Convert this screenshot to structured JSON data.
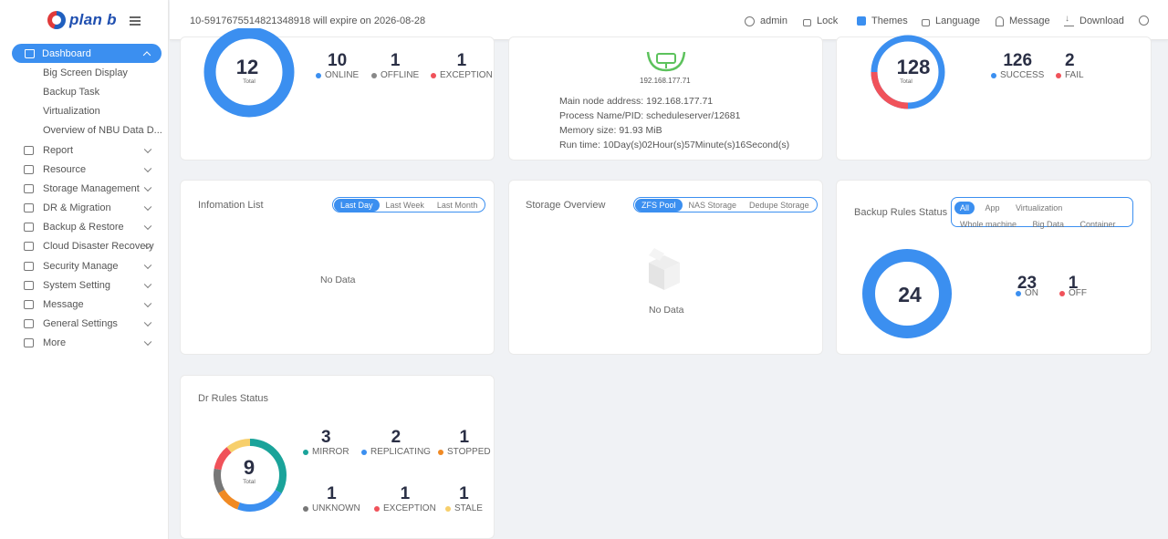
{
  "brand": {
    "logo_text": "plan b"
  },
  "header": {
    "expire_text": "10-5917675514821348918 will expire on 2026-08-28",
    "user": "admin",
    "lock": "Lock",
    "themes": "Themes",
    "language": "Language",
    "message": "Message",
    "download": "Download"
  },
  "sidebar": {
    "active": "Dashboard",
    "sub_items": [
      "Big Screen Display",
      "Backup Task",
      "Virtualization",
      "Overview of NBU Data D..."
    ],
    "items": [
      "Report",
      "Resource",
      "Storage Management",
      "DR & Migration",
      "Backup & Restore",
      "Cloud Disaster Recovery",
      "Security Manage",
      "System Setting",
      "Message",
      "General Settings",
      "More"
    ]
  },
  "client_card": {
    "total": "12",
    "total_label": "Total",
    "stats": [
      {
        "value": "10",
        "label": "ONLINE",
        "color": "#3b8ff0"
      },
      {
        "value": "1",
        "label": "OFFLINE",
        "color": "#888888"
      },
      {
        "value": "1",
        "label": "EXCEPTION",
        "color": "#f0525a"
      }
    ]
  },
  "node_card": {
    "ip": "192.168.177.71",
    "lines": [
      "Main node address: 192.168.177.71",
      "Process Name/PID: scheduleserver/12681",
      "Memory size: 91.93 MiB",
      "Run time: 10Day(s)02Hour(s)57Minute(s)16Second(s)"
    ]
  },
  "task_card": {
    "total": "128",
    "total_label": "Total",
    "stats": [
      {
        "value": "126",
        "label": "SUCCESS",
        "color": "#3b8ff0"
      },
      {
        "value": "2",
        "label": "FAIL",
        "color": "#f0525a"
      }
    ]
  },
  "info_list": {
    "title": "Infomation List",
    "tabs": [
      "Last Day",
      "Last Week",
      "Last Month"
    ],
    "empty": "No Data"
  },
  "storage": {
    "title": "Storage Overview",
    "tabs": [
      "ZFS Pool",
      "NAS Storage",
      "Dedupe Storage"
    ],
    "empty": "No Data"
  },
  "backup_rules": {
    "title": "Backup Rules Status",
    "tabs": [
      "All",
      "App",
      "Virtualization",
      "Whole machine",
      "Big Data",
      "Container"
    ],
    "total": "24",
    "stats": [
      {
        "value": "23",
        "label": "ON",
        "color": "#3b8ff0"
      },
      {
        "value": "1",
        "label": "OFF",
        "color": "#f0525a"
      }
    ]
  },
  "dr_rules": {
    "title": "Dr Rules Status",
    "total": "9",
    "total_label": "Total",
    "stats": [
      {
        "value": "3",
        "label": "MIRROR",
        "color": "#1aa39a"
      },
      {
        "value": "2",
        "label": "REPLICATING",
        "color": "#3b8ff0"
      },
      {
        "value": "1",
        "label": "STOPPED",
        "color": "#f08a24"
      },
      {
        "value": "1",
        "label": "UNKNOWN",
        "color": "#777777"
      },
      {
        "value": "1",
        "label": "EXCEPTION",
        "color": "#f0525a"
      },
      {
        "value": "1",
        "label": "STALE",
        "color": "#f7cf6b"
      }
    ]
  }
}
